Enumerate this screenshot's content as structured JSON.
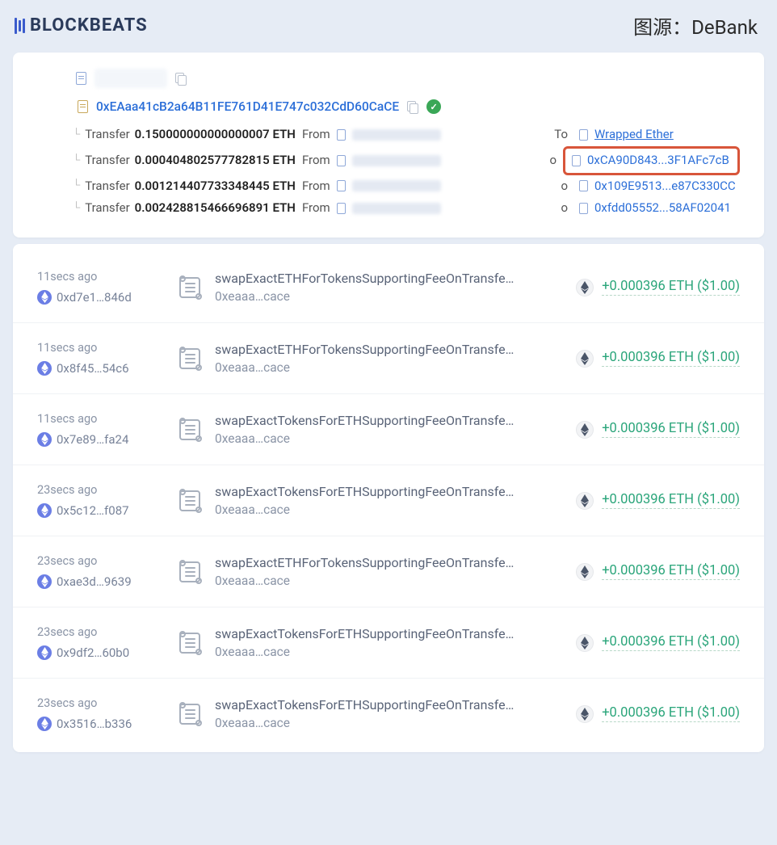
{
  "brand": "BLOCKBEATS",
  "source_label": "图源：DeBank",
  "transaction": {
    "address": "0xEAaa41cB2a64B11FE761D41E747c032CdD60CaCE",
    "transfers": [
      {
        "label": "Transfer",
        "amount": "0.150000000000000007 ETH",
        "from": "From",
        "to": "To",
        "dest": "Wrapped Ether",
        "highlight": false,
        "underline": true
      },
      {
        "label": "Transfer",
        "amount": "0.000404802577782815 ETH",
        "from": "From",
        "to": "o",
        "dest": "0xCA90D843...3F1AFc7cB",
        "highlight": true
      },
      {
        "label": "Transfer",
        "amount": "0.001214407733348445 ETH",
        "from": "From",
        "to": "o",
        "dest": "0x109E9513...e87C330CC",
        "highlight": false
      },
      {
        "label": "Transfer",
        "amount": "0.002428815466696891 ETH",
        "from": "From",
        "to": "o",
        "dest": "0xfdd05552...58AF02041",
        "highlight": false
      }
    ]
  },
  "tx_list": [
    {
      "time": "11secs ago",
      "hash": "0xd7e1…846d",
      "fn": "swapExactETHForTokensSupportingFeeOnTransfe…",
      "addr": "0xeaaa…cace",
      "amount": "+0.000396 ETH ($1.00)"
    },
    {
      "time": "11secs ago",
      "hash": "0x8f45…54c6",
      "fn": "swapExactETHForTokensSupportingFeeOnTransfe…",
      "addr": "0xeaaa…cace",
      "amount": "+0.000396 ETH ($1.00)"
    },
    {
      "time": "11secs ago",
      "hash": "0x7e89…fa24",
      "fn": "swapExactTokensForETHSupportingFeeOnTransfe…",
      "addr": "0xeaaa…cace",
      "amount": "+0.000396 ETH ($1.00)"
    },
    {
      "time": "23secs ago",
      "hash": "0x5c12…f087",
      "fn": "swapExactTokensForETHSupportingFeeOnTransfe…",
      "addr": "0xeaaa…cace",
      "amount": "+0.000396 ETH ($1.00)"
    },
    {
      "time": "23secs ago",
      "hash": "0xae3d…9639",
      "fn": "swapExactETHForTokensSupportingFeeOnTransfe…",
      "addr": "0xeaaa…cace",
      "amount": "+0.000396 ETH ($1.00)"
    },
    {
      "time": "23secs ago",
      "hash": "0x9df2…60b0",
      "fn": "swapExactTokensForETHSupportingFeeOnTransfe…",
      "addr": "0xeaaa…cace",
      "amount": "+0.000396 ETH ($1.00)"
    },
    {
      "time": "23secs ago",
      "hash": "0x3516…b336",
      "fn": "swapExactTokensForETHSupportingFeeOnTransfe…",
      "addr": "0xeaaa…cace",
      "amount": "+0.000396 ETH ($1.00)"
    }
  ]
}
